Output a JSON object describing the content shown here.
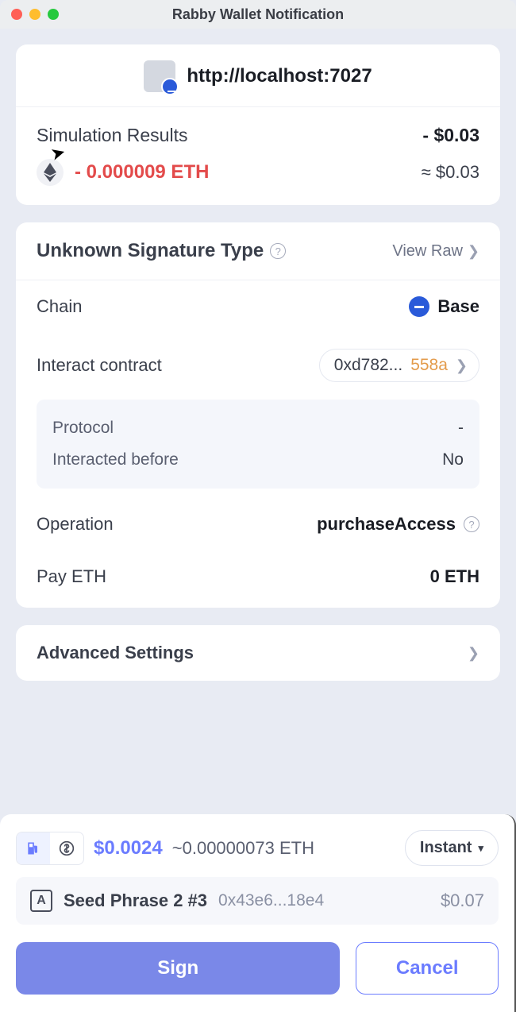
{
  "window": {
    "title": "Rabby Wallet Notification"
  },
  "origin": {
    "url": "http://localhost:7027"
  },
  "simulation": {
    "label": "Simulation Results",
    "total": "- $0.03",
    "asset_amount": "- 0.000009 ETH",
    "asset_approx": "≈ $0.03"
  },
  "signature": {
    "title": "Unknown Signature Type",
    "view_raw": "View Raw",
    "rows": {
      "chain_label": "Chain",
      "chain_value": "Base",
      "contract_label": "Interact contract",
      "contract_prefix": "0xd782...",
      "contract_suffix": "558a",
      "protocol_label": "Protocol",
      "protocol_value": "-",
      "interacted_label": "Interacted before",
      "interacted_value": "No",
      "operation_label": "Operation",
      "operation_value": "purchaseAccess",
      "pay_label": "Pay ETH",
      "pay_value": "0 ETH"
    }
  },
  "advanced": {
    "label": "Advanced Settings"
  },
  "gas": {
    "usd": "$0.0024",
    "eth": "~0.00000073 ETH",
    "speed": "Instant"
  },
  "account": {
    "icon_letter": "A",
    "name": "Seed Phrase 2 #3",
    "addr": "0x43e6...18e4",
    "balance": "$0.07"
  },
  "buttons": {
    "sign": "Sign",
    "cancel": "Cancel"
  }
}
